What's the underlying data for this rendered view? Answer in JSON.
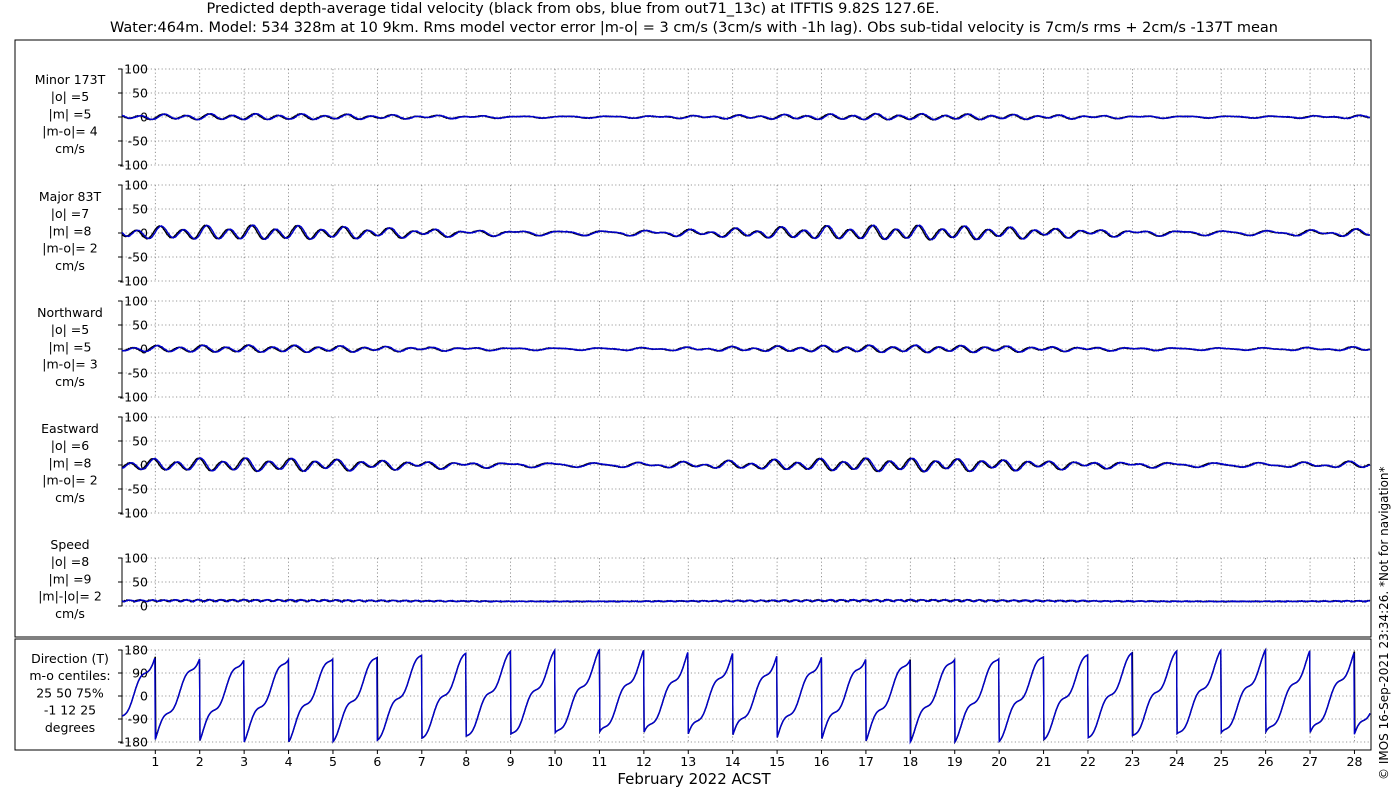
{
  "title_line1": "Predicted depth-average tidal velocity (black from obs, blue from out71_13c) at ITFTIS 9.82S 127.6E.",
  "title_line2": "Water:464m. Model: 534 328m at 10 9km. Rms model vector error |m-o| = 3 cm/s (3cm/s with -1h lag). Obs sub-tidal velocity is 7cm/s rms + 2cm/s -137T mean",
  "credit": "© IMOS 16-Sep-2021 23:34:26. *Not for navigation*",
  "colors": {
    "obs": "#000000",
    "model": "#0000cc",
    "grid": "#7a7a7a"
  },
  "chart_data": {
    "type": "line",
    "xlabel": "February 2022 ACST",
    "x_ticks": [
      "1",
      "2",
      "3",
      "4",
      "5",
      "6",
      "7",
      "8",
      "9",
      "10",
      "11",
      "12",
      "13",
      "14",
      "15",
      "16",
      "17",
      "18",
      "19",
      "20",
      "21",
      "22",
      "23",
      "24",
      "25",
      "26",
      "27",
      "28"
    ],
    "xlim": [
      0.25,
      28.35
    ],
    "grid": true,
    "series": [
      {
        "name": "obs",
        "color": "#000000"
      },
      {
        "name": "model",
        "color": "#0000cc"
      }
    ],
    "panels": [
      {
        "id": "minor",
        "label_lines": [
          "Minor 173T",
          "|o| =5",
          "|m| =5",
          "|m-o|= 4",
          "cm/s"
        ],
        "ylim": [
          -100,
          100
        ],
        "yticks": [
          -100,
          -50,
          0,
          50,
          100
        ],
        "ytick_labels": [
          "-100",
          "-50",
          "0",
          "50",
          "100"
        ],
        "kind": "vel",
        "amp": 5,
        "offset": 0
      },
      {
        "id": "major",
        "label_lines": [
          "Major 83T",
          "|o| =7",
          "|m| =8",
          "|m-o|= 2",
          "cm/s"
        ],
        "ylim": [
          -100,
          100
        ],
        "yticks": [
          -100,
          -50,
          0,
          50,
          100
        ],
        "ytick_labels": [
          "-100",
          "-50",
          "0",
          "50",
          "100"
        ],
        "kind": "vel",
        "amp": 12,
        "offset": 0
      },
      {
        "id": "northward",
        "label_lines": [
          "Northward",
          "|o| =5",
          "|m| =5",
          "|m-o|= 3",
          "cm/s"
        ],
        "ylim": [
          -100,
          100
        ],
        "yticks": [
          -100,
          -50,
          0,
          50,
          100
        ],
        "ytick_labels": [
          "-100",
          "-50",
          "0",
          "50",
          "100"
        ],
        "kind": "vel",
        "amp": 6,
        "offset": 0
      },
      {
        "id": "eastward",
        "label_lines": [
          "Eastward",
          "|o| =6",
          "|m| =8",
          "|m-o|= 2",
          "cm/s"
        ],
        "ylim": [
          -100,
          100
        ],
        "yticks": [
          -100,
          -50,
          0,
          50,
          100
        ],
        "ytick_labels": [
          "-100",
          "-50",
          "0",
          "50",
          "100"
        ],
        "kind": "vel",
        "amp": 11,
        "offset": 0
      },
      {
        "id": "speed",
        "label_lines": [
          "Speed",
          "|o| =8",
          "|m| =9",
          "|m|-|o|= 2",
          "cm/s"
        ],
        "ylim": [
          0,
          100
        ],
        "yticks": [
          0,
          50,
          100
        ],
        "ytick_labels": [
          "0",
          "50",
          "100"
        ],
        "kind": "speed",
        "amp": 4,
        "offset": 9
      },
      {
        "id": "direction",
        "label_lines": [
          "Direction (T)",
          "m-o centiles:",
          "25  50  75%",
          "-1  12  25",
          "degrees"
        ],
        "ylim": [
          -180,
          180
        ],
        "yticks": [
          -180,
          -90,
          0,
          90,
          180
        ],
        "ytick_labels": [
          "-180",
          "-90",
          "0",
          "90",
          "180"
        ],
        "kind": "direction",
        "amp": 180,
        "offset": 0
      }
    ]
  }
}
